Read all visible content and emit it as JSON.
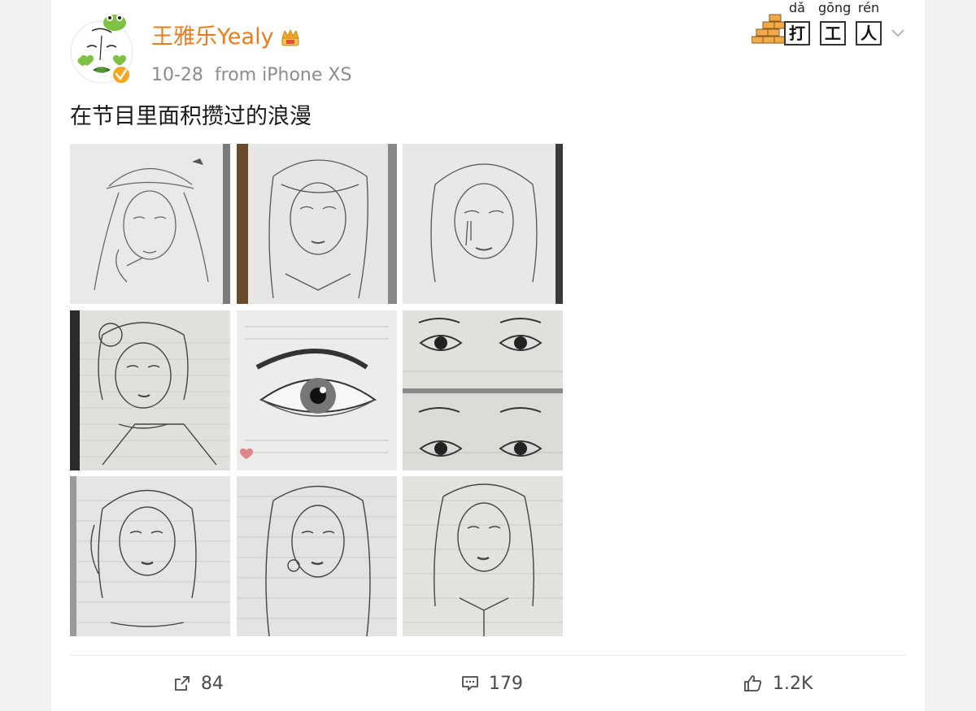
{
  "post": {
    "author": "王雅乐Yealy",
    "date": "10-28",
    "source": "from iPhone XS",
    "text": "在节目里面积攒过的浪漫"
  },
  "badge": {
    "pinyin": [
      "dǎ",
      "gōng",
      "rén"
    ],
    "chars": [
      "打",
      "工",
      "人"
    ]
  },
  "images": [
    {
      "icon": "sketch-girl-beanie"
    },
    {
      "icon": "sketch-girl-bangs-braid"
    },
    {
      "icon": "sketch-girl-tears"
    },
    {
      "icon": "sketch-girl-bun"
    },
    {
      "icon": "sketch-eye-closeup"
    },
    {
      "icon": "sketch-eyes-pairs"
    },
    {
      "icon": "sketch-girl-pigtails"
    },
    {
      "icon": "sketch-girl-long-hair"
    },
    {
      "icon": "sketch-girl-collar"
    }
  ],
  "actions": {
    "repost": "84",
    "comments": "179",
    "likes": "1.2K"
  },
  "colors": {
    "username": "#ea7c1e",
    "meta": "#8c8c8c",
    "verified": "#f5a623",
    "avatar_green": "#7dc243"
  }
}
